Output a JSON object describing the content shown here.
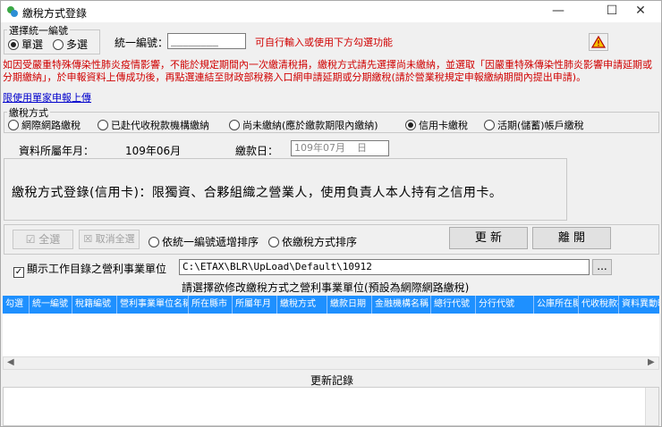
{
  "window": {
    "title": "繳稅方式登錄",
    "minimize": "—",
    "maximize": "☐",
    "close": "✕"
  },
  "select_mode": {
    "group_title": "選擇統一編號",
    "single": "單選",
    "multiple": "多選"
  },
  "tax_id": {
    "label": "統一編號：",
    "value": "________",
    "hint": "可自行輸入或使用下方勾選功能"
  },
  "notice": "如因受嚴重特殊傳染性肺炎疫情影響，不能於規定期間內一次繳清稅捐，繳稅方式請先選擇尚未繳納，並選取「因嚴重特殊傳染性肺炎影響申請延期或分期繳納」，於申報資料上傳成功後，再點選連結至財政部稅務入口網申請延期或分期繳稅(請於營業稅規定申報繳納期間內提出申請)。",
  "link": "限使用單家申報上傳",
  "payment_method": {
    "group_title": "繳稅方式",
    "options": [
      "網際網路繳稅",
      "已赴代收稅款機構繳納",
      "尚未繳納(應於繳款期限內繳納)",
      "信用卡繳稅",
      "活期(儲蓄)帳戶繳稅"
    ],
    "selected_index": 3
  },
  "period": {
    "label": "資料所屬年月：",
    "value": "109年06月",
    "pay_date_label": "繳款日：",
    "pay_date_value": "109年07月",
    "pay_date_suffix": "日"
  },
  "description": "繳稅方式登錄(信用卡)：限獨資、合夥組織之營業人，使用負責人本人持有之信用卡。",
  "actions": {
    "select_all": "全選",
    "deselect_all": "取消全選",
    "sort_by_id": "依統一編號遞增排序",
    "sort_by_method": "依繳稅方式排序",
    "update": "更 新",
    "leave": "離 開"
  },
  "directory": {
    "label": "顯示工作目錄之營利事業單位",
    "path": "C:\\ETAX\\BLR\\UpLoad\\Default\\10912",
    "browse": "..."
  },
  "grid": {
    "caption": "請選擇欲修改繳稅方式之營利事業單位(預設為網際網路繳稅)",
    "columns": [
      "勾選",
      "統一編號",
      "稅籍編號",
      "營利事業單位名稱",
      "所在縣市",
      "所屬年月",
      "繳稅方式",
      "繳款日期",
      "金融機構名稱",
      "總行代號",
      "分行代號",
      "公庫所在縣",
      "代收稅款機",
      "資料異動時"
    ]
  },
  "log": {
    "caption": "更新記錄"
  }
}
